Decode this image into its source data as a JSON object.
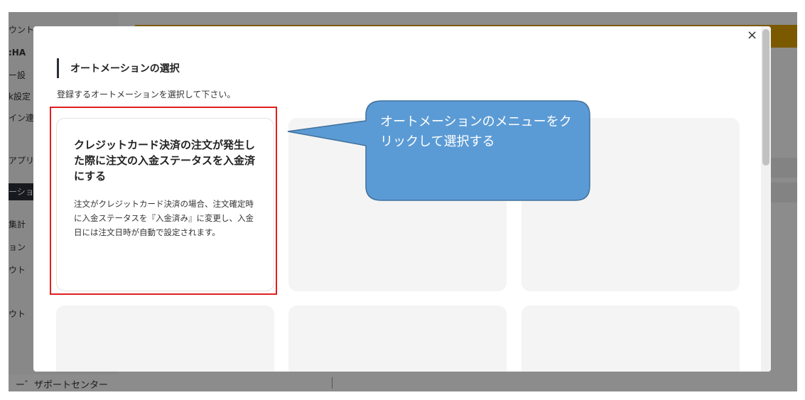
{
  "background": {
    "sidebar_items": [
      {
        "label": "ウント",
        "active": false
      },
      {
        "label": ":HA",
        "active": false
      },
      {
        "label": "ー設",
        "active": false
      },
      {
        "label": "k設定",
        "active": false
      },
      {
        "label": "イン連",
        "active": false
      },
      {
        "label": "アプリ",
        "active": false
      },
      {
        "label": "ーション",
        "active": true
      },
      {
        "label": "集計",
        "active": false
      },
      {
        "label": "ョン",
        "active": false
      },
      {
        "label": "ウト",
        "active": false
      },
      {
        "label": "ウト",
        "active": false
      }
    ],
    "footer_text": "ー゛ザポートセンター"
  },
  "modal": {
    "title": "オートメーションの選択",
    "description": "登録するオートメーションを選択して下さい。",
    "close_label": "×",
    "cards": [
      {
        "title": "クレジットカード決済の注文が発生した際に注文の入金ステータスを入金済にする",
        "description": "注文がクレジットカード決済の場合、注文確定時に入金ステータスを『入金済み』に変更し、入金日には注文日時が自動で設定されます。"
      },
      {
        "title": "",
        "description": ""
      },
      {
        "title": "",
        "description": ""
      },
      {
        "title": "",
        "description": ""
      },
      {
        "title": "",
        "description": ""
      },
      {
        "title": "",
        "description": ""
      }
    ]
  },
  "callout": {
    "text": "オートメーションのメニューをクリックして選択する",
    "fill_color": "#5b9bd5",
    "border_color": "#41719c"
  },
  "colors": {
    "highlight": "#e02020",
    "banner": "#e0a300"
  }
}
